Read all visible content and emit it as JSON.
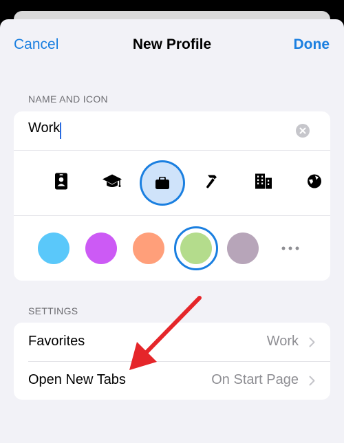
{
  "nav": {
    "cancel": "Cancel",
    "title": "New Profile",
    "done": "Done"
  },
  "name_icon_section": {
    "header": "NAME AND ICON",
    "name_value": "Work",
    "icons": [
      "id-card-icon",
      "graduation-cap-icon",
      "briefcase-icon",
      "hammer-icon",
      "building-icon",
      "globe-icon"
    ],
    "selected_icon": "briefcase-icon",
    "colors": [
      "#5ac8fa",
      "#cc5af5",
      "#ff9f7a",
      "#b4dc8c",
      "#b7a5b9"
    ],
    "selected_color": "#b4dc8c"
  },
  "settings_section": {
    "header": "SETTINGS",
    "rows": [
      {
        "label": "Favorites",
        "value": "Work"
      },
      {
        "label": "Open New Tabs",
        "value": "On Start Page"
      }
    ]
  },
  "theme": {
    "accent": "#1a7fe0",
    "annotation_arrow": "#e5262a"
  }
}
